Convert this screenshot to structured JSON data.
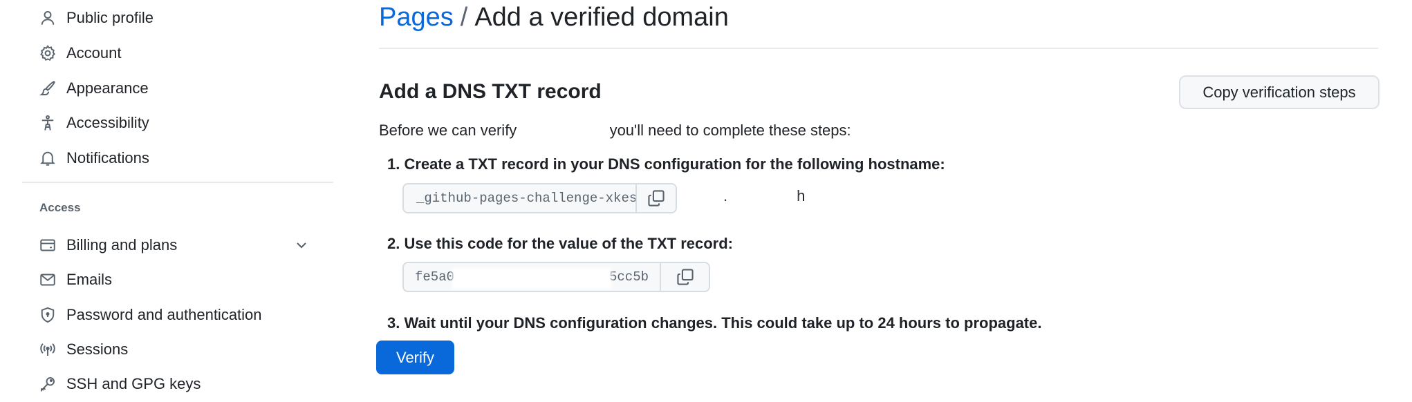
{
  "sidebar": {
    "items_top": [
      {
        "label": "Public profile",
        "icon": "person-icon"
      },
      {
        "label": "Account",
        "icon": "gear-icon"
      },
      {
        "label": "Appearance",
        "icon": "paintbrush-icon"
      },
      {
        "label": "Accessibility",
        "icon": "accessibility-icon"
      },
      {
        "label": "Notifications",
        "icon": "bell-icon"
      }
    ],
    "access_heading": "Access",
    "items_access": [
      {
        "label": "Billing and plans",
        "icon": "credit-card-icon",
        "expandable": true
      },
      {
        "label": "Emails",
        "icon": "mail-icon"
      },
      {
        "label": "Password and authentication",
        "icon": "shield-lock-icon"
      },
      {
        "label": "Sessions",
        "icon": "broadcast-icon"
      },
      {
        "label": "SSH and GPG keys",
        "icon": "key-icon"
      }
    ]
  },
  "header": {
    "breadcrumb_parent": "Pages",
    "separator": "/",
    "title": "Add a verified domain"
  },
  "main": {
    "section_title": "Add a DNS TXT record",
    "copy_steps_label": "Copy verification steps",
    "intro_before": "Before we can verify",
    "intro_after": "you'll need to complete these steps:",
    "steps": [
      {
        "text": "1. Create a TXT record in your DNS configuration for the following hostname:"
      },
      {
        "text": "2. Use this code for the value of the TXT record:"
      },
      {
        "text": "3. Wait until your DNS configuration changes. This could take up to 24 hours to propagate."
      }
    ],
    "hostname_value": "_github-pages-challenge-xkeshav",
    "hostname_suffix_prefix": ".",
    "hostname_suffix_end": "h",
    "code_value_start": "fe5a0",
    "code_value_end": "5cc5b",
    "verify_label": "Verify"
  },
  "colors": {
    "accent": "#0969da",
    "text": "#1f2328",
    "muted": "#59636e",
    "border": "#d8dde2"
  }
}
